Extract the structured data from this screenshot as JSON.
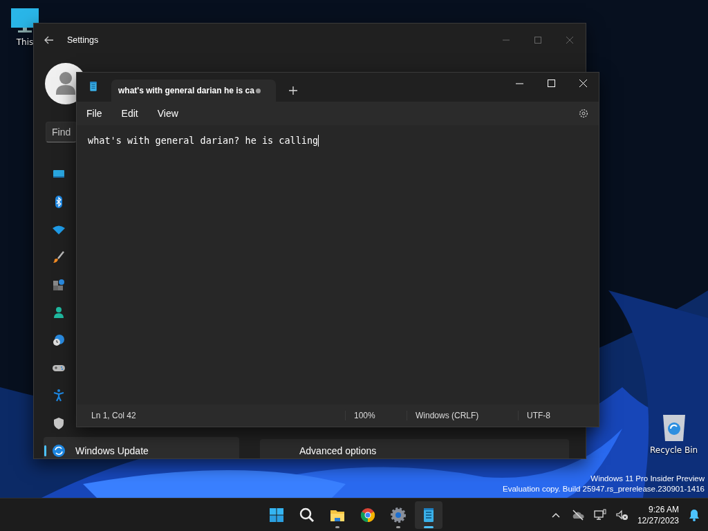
{
  "desktop": {
    "icons": [
      {
        "label": "This"
      },
      {
        "label": "Recycle Bin"
      }
    ],
    "watermark": [
      "Windows 11 Pro Insider Preview",
      "Evaluation copy. Build 25947.rs_prerelease.230901-1416"
    ]
  },
  "settings": {
    "title": "Settings",
    "search": {
      "placeholder": "Find"
    },
    "sidebar": {
      "items": [
        {
          "selected": false
        },
        {
          "selected": false
        },
        {
          "selected": false
        },
        {
          "selected": false
        },
        {
          "selected": false
        },
        {
          "selected": false
        },
        {
          "selected": false
        },
        {
          "selected": false
        },
        {
          "selected": false
        },
        {
          "selected": false
        },
        {
          "label": "Windows Update",
          "selected": true
        }
      ]
    },
    "cards": [
      "Advanced options"
    ]
  },
  "notepad": {
    "tab": {
      "title": "what's with general darian he is ca",
      "modified": true
    },
    "menu": [
      "File",
      "Edit",
      "View"
    ],
    "text": "what's with general darian? he is calling",
    "status_bar": [
      "Ln 1, Col 42",
      "100%",
      "Windows (CRLF)",
      "UTF-8"
    ]
  },
  "taskbar": {
    "apps": [
      {
        "running": false,
        "active": false
      },
      {
        "running": false,
        "active": false
      },
      {
        "running": true,
        "active": false
      },
      {
        "running": false,
        "active": false
      },
      {
        "running": true,
        "active": false
      },
      {
        "running": true,
        "active": true
      }
    ],
    "time": "9:26 AM",
    "date": "12/27/2023"
  }
}
